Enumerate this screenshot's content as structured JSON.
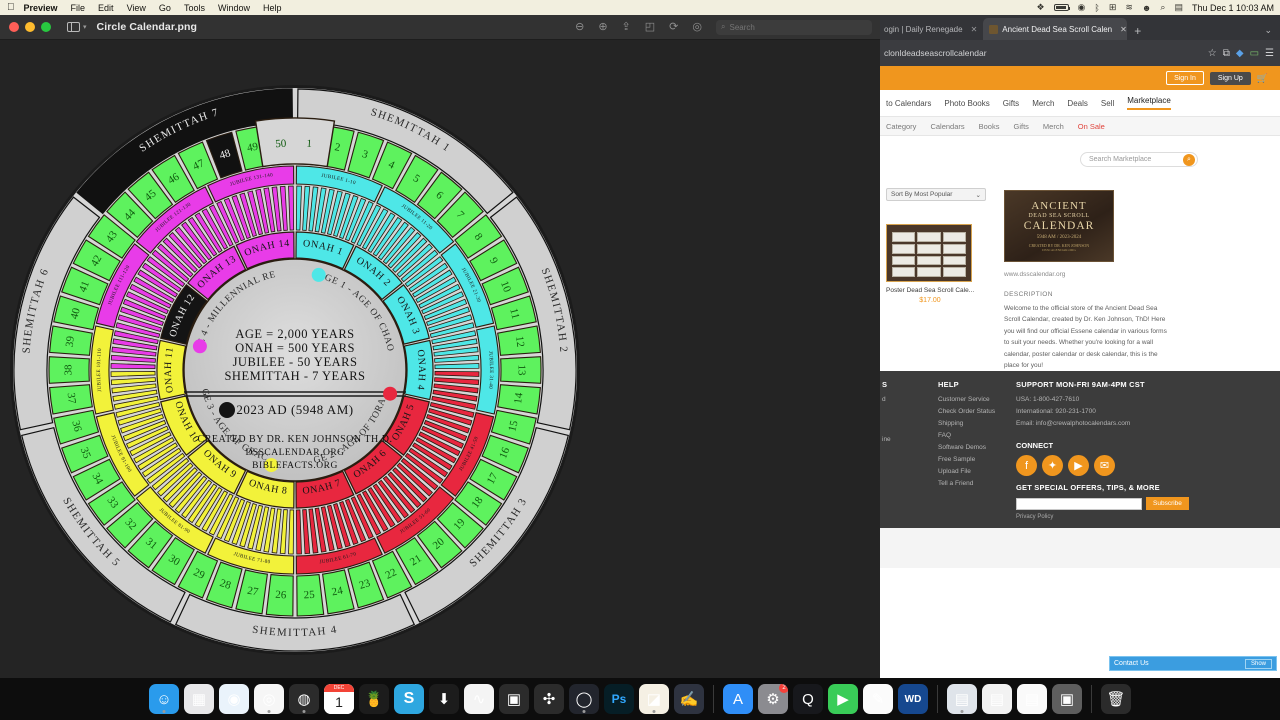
{
  "menubar": {
    "apple": "apple-logo",
    "items": [
      "Preview",
      "File",
      "Edit",
      "View",
      "Go",
      "Tools",
      "Window",
      "Help"
    ],
    "clock": "Thu Dec 1  10:03 AM",
    "status_icons": [
      "control-center-icon",
      "battery-icon",
      "bluetooth-icon",
      "display-icon",
      "wifi-icon",
      "user-icon",
      "search-icon",
      "siri-icon"
    ]
  },
  "preview": {
    "document_title": "Circle Calendar.png",
    "toolbar": {
      "zoom_out": "zoom-out-icon",
      "zoom_in": "zoom-in-icon",
      "share": "share-icon",
      "markup": "markup-icon",
      "rotate": "rotate-icon",
      "annotate": "annotate-icon",
      "search_placeholder": "Search"
    }
  },
  "calendar": {
    "center": {
      "lines": [
        "AGE = 2,000 YEARS",
        "ONAH = 500 YEARS",
        "JUBILEE - 50 YEARS",
        "SHEMITTAH - 7 YEARS"
      ],
      "current_marker": "2023 AD (5948 AM)",
      "credits": [
        "CREATED BY DR. KEN JOHNSON TH.D.",
        "DSSCALENDAR.ORG",
        "BIBLEFACTS.ORG"
      ]
    },
    "ages": [
      {
        "label": "AGE 1 - AGE OF CHAOS",
        "color": "#4ee7e7"
      },
      {
        "label": "AGE 2 - AGE OF TORAH",
        "color": "#e8273f"
      },
      {
        "label": "AGE 3 - AGE OF GRACE",
        "color": "#f2f23a"
      },
      {
        "label": "AGE 4 - MILLENNIAL REIGN",
        "color": "#e83ce8"
      }
    ],
    "shemittah_labels": [
      "SHEMITTAH 1",
      "SHEMITTAH 2",
      "SHEMITTAH 3",
      "SHEMITTAH 4",
      "SHEMITTAH 5",
      "SHEMITTAH 6",
      "SHEMITTAH 7"
    ],
    "onah_labels": [
      "ONAH 1",
      "ONAH 2",
      "ONAH 3",
      "ONAH 4",
      "ONAH 5",
      "ONAH 6",
      "ONAH 7",
      "ONAH 8",
      "ONAH 9",
      "ONAH 10",
      "ONAH 11",
      "ONAH 12",
      "ONAH 13",
      "ONAH 14"
    ],
    "jubilee_labels": [
      "JUBILEE 1-10",
      "JUBILEE 11-20",
      "JUBILEE 21-30",
      "JUBILEE 31-40",
      "JUBILEE 41-50",
      "JUBILEE 51-60",
      "JUBILEE 61-70",
      "JUBILEE 71-80",
      "JUBILEE 81-90",
      "JUBILEE 91-100",
      "JUBILEE 101-110",
      "JUBILEE 111-120",
      "JUBILEE 121-130",
      "JUBILEE 131-140"
    ],
    "ring_numbers": [
      1,
      2,
      3,
      4,
      5,
      6,
      7,
      8,
      9,
      10,
      11,
      12,
      13,
      14,
      15,
      16,
      17,
      18,
      19,
      20,
      21,
      22,
      23,
      24,
      25,
      26,
      27,
      28,
      29,
      30,
      31,
      32,
      33,
      34,
      35,
      36,
      37,
      38,
      39,
      40,
      41,
      42,
      43,
      44,
      45,
      46,
      47,
      48,
      49,
      50
    ]
  },
  "browser": {
    "tabs": [
      {
        "title": "ogin | Daily Renegade",
        "active": false
      },
      {
        "title": "Ancient Dead Sea Scroll Calen",
        "active": true
      }
    ],
    "new_tab": "+",
    "url": "clonldeadseascrollcalendar",
    "toolbar_icons": [
      "bookmark-star-icon",
      "extensions-icon",
      "profile-icon",
      "cast-icon",
      "menu-icon"
    ]
  },
  "site": {
    "account": {
      "sign_in": "Sign In",
      "sign_up": "Sign Up",
      "cart": "cart-icon"
    },
    "mainnav": [
      {
        "label": "to Calendars",
        "active": false
      },
      {
        "label": "Photo Books",
        "active": false
      },
      {
        "label": "Gifts",
        "active": false
      },
      {
        "label": "Merch",
        "active": false
      },
      {
        "label": "Deals",
        "active": false
      },
      {
        "label": "Sell",
        "active": false
      },
      {
        "label": "Marketplace",
        "active": true
      }
    ],
    "subnav": [
      {
        "label": "Category",
        "sale": false
      },
      {
        "label": "Calendars",
        "sale": false
      },
      {
        "label": "Books",
        "sale": false
      },
      {
        "label": "Gifts",
        "sale": false
      },
      {
        "label": "Merch",
        "sale": false
      },
      {
        "label": "On Sale",
        "sale": true
      }
    ],
    "search": {
      "placeholder": "Search Marketplace",
      "button": "search-icon"
    },
    "sort": {
      "value": "Sort By Most Popular"
    },
    "product": {
      "title": "Poster Dead Sea Scroll Cale...",
      "price": "$17.00"
    },
    "banner": {
      "line1": "ANCIENT",
      "line2": "DEAD SEA SCROLL",
      "line3": "CALENDAR",
      "line4": "5948 AM / 2023-2024",
      "line5": "CREATED BY DR. KEN JOHNSON",
      "line6": "DSSCALENDAR.ORG"
    },
    "store_url": "www.dsscalendar.org",
    "description": {
      "heading": "DESCRIPTION",
      "body": "Welcome to the official store of the Ancient Dead Sea Scroll Calendar, created by Dr. Ken Johnson, ThD! Here you will find our official Essene calendar in various forms to suit your needs. Whether you're looking for a wall calendar, poster calendar or desk calendar, this is the place for you!"
    },
    "footer": {
      "col0_header": "S",
      "col0_items": [
        "d",
        "ine"
      ],
      "help_header": "HELP",
      "help_items": [
        "Customer Service",
        "Check Order Status",
        "Shipping",
        "FAQ",
        "Software Demos",
        "Free Sample",
        "Upload File",
        "Tell a Friend"
      ],
      "support_header": "SUPPORT MON-FRI 9AM-4PM CST",
      "support_items": [
        "USA: 1-800-427-7610",
        "International: 920-231-1700",
        "Email: info@crewalphotocalendars.com"
      ],
      "connect_header": "CONNECT",
      "socials": [
        "facebook-icon",
        "twitter-icon",
        "youtube-icon",
        "email-icon"
      ],
      "newsletter_header": "GET SPECIAL OFFERS, TIPS, & MORE",
      "newsletter_button": "Subscribe",
      "privacy": "Privacy Policy"
    },
    "contact_widget": {
      "label": "Contact Us",
      "button": "Show"
    }
  },
  "dock": {
    "items": [
      {
        "name": "finder",
        "glyph": "☺",
        "bg": "#2a9bec",
        "running": true
      },
      {
        "name": "launchpad",
        "glyph": "▦",
        "bg": "#e8e8ea",
        "running": false
      },
      {
        "name": "safari",
        "glyph": "◉",
        "bg": "#eaf3fb",
        "running": false
      },
      {
        "name": "chrome",
        "glyph": "◎",
        "bg": "#f6f6f6",
        "running": true
      },
      {
        "name": "firefox",
        "glyph": "◍",
        "bg": "#2b2b2b",
        "running": true
      },
      {
        "name": "calendar",
        "glyph": "1",
        "bg": "#ffffff",
        "running": false
      },
      {
        "name": "fruits",
        "glyph": "🍍",
        "bg": "#1c1c1c",
        "running": false
      },
      {
        "name": "skype",
        "glyph": "S",
        "bg": "#2ea7e0",
        "running": false
      },
      {
        "name": "downloads",
        "glyph": "⬇",
        "bg": "#1c1c1c",
        "running": false
      },
      {
        "name": "audio-hijack",
        "glyph": "∿",
        "bg": "#f4f4f4",
        "running": false
      },
      {
        "name": "final-cut-pro",
        "glyph": "▣",
        "bg": "#2b2b2b",
        "running": false
      },
      {
        "name": "davinci-resolve",
        "glyph": "✣",
        "bg": "#2b2b2b",
        "running": false
      },
      {
        "name": "obs-studio",
        "glyph": "◯",
        "bg": "#22252d",
        "running": true
      },
      {
        "name": "photoshop",
        "glyph": "Ps",
        "bg": "#061e26",
        "running": false
      },
      {
        "name": "wondershare",
        "glyph": "◪",
        "bg": "#f5f0e4",
        "running": true
      },
      {
        "name": "notability",
        "glyph": "✍",
        "bg": "#2e3340",
        "running": false
      },
      {
        "name": "app-store",
        "glyph": "A",
        "bg": "#2f8ef7",
        "running": false
      },
      {
        "name": "system-settings",
        "glyph": "⚙",
        "bg": "#8b8b90",
        "running": false,
        "badge": "2"
      },
      {
        "name": "quicktime",
        "glyph": "Q",
        "bg": "#17181c",
        "running": false
      },
      {
        "name": "facetime",
        "glyph": "▶",
        "bg": "#39cc58",
        "running": false
      },
      {
        "name": "notes",
        "glyph": "✎",
        "bg": "#fbfbfb",
        "running": false
      },
      {
        "name": "wd-drive",
        "glyph": "WD",
        "bg": "#16488f",
        "running": false
      },
      {
        "name": "preview",
        "glyph": "▤",
        "bg": "#dfe4ea",
        "running": true
      },
      {
        "name": "document-pdf",
        "glyph": "▤",
        "bg": "#f2f2f2",
        "running": false
      },
      {
        "name": "document-page",
        "glyph": "▤",
        "bg": "#fafafa",
        "running": false
      },
      {
        "name": "screenshot",
        "glyph": "▣",
        "bg": "#5e5e5e",
        "running": false
      },
      {
        "name": "trash",
        "glyph": "🗑",
        "bg": "#2b2b2b",
        "running": false
      }
    ]
  }
}
